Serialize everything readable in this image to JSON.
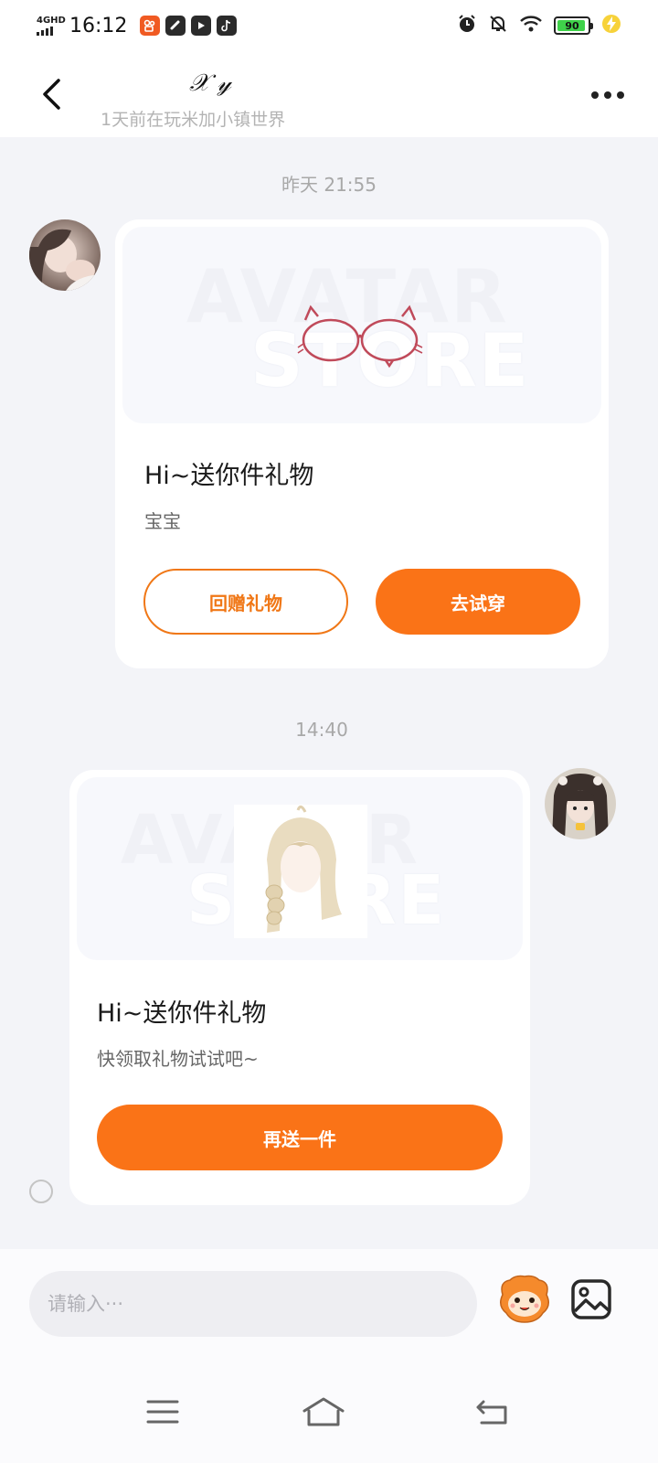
{
  "status_bar": {
    "network": "4GHD",
    "time": "16:12",
    "battery": "90",
    "app_icons": [
      "kuaishou-icon",
      "link-icon",
      "play-icon",
      "tiktok-icon"
    ],
    "right_icons": [
      "alarm-icon",
      "mute-icon",
      "wifi-icon",
      "battery-icon",
      "charging-icon"
    ]
  },
  "header": {
    "title": "𝒳 𝓎",
    "subtitle": "1天前在玩米加小镇世界"
  },
  "messages": {
    "ts1": "昨天 21:55",
    "card1": {
      "watermark_line1": "AVATAR",
      "watermark_line2": "STORE",
      "title": "Hi~送你件礼物",
      "subtitle": "宝宝",
      "btn_return": "回赠礼物",
      "btn_try": "去试穿"
    },
    "ts2": "14:40",
    "card2": {
      "watermark_line1": "AVATAR",
      "watermark_line2": "STORE",
      "title": "Hi~送你件礼物",
      "subtitle": "快领取礼物试试吧~",
      "btn_send": "再送一件"
    }
  },
  "input_bar": {
    "placeholder": "请输入···"
  },
  "colors": {
    "accent": "#fa7317",
    "background": "#f3f4f8",
    "card": "#ffffff",
    "muted_text": "#a8a8a8"
  }
}
